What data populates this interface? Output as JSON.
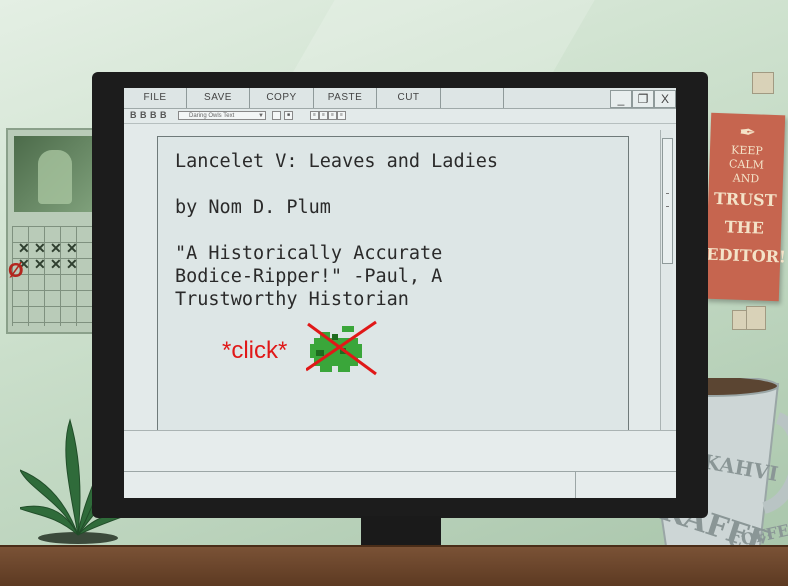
{
  "toolbar": {
    "menu": [
      "FILE",
      "SAVE",
      "COPY",
      "PASTE",
      "CUT"
    ],
    "window_buttons": [
      "_",
      "❐",
      "X"
    ]
  },
  "format_bar": {
    "style_buttons": [
      "B",
      "B",
      "B",
      "B"
    ],
    "font_name": "Daring Owls Text"
  },
  "document": {
    "lines": [
      "Lancelet V: Leaves and Ladies",
      "by Nom D. Plum",
      "\"A Historically Accurate",
      "Bodice-Ripper!\" -Paul, A",
      "Trustworthy Historian"
    ]
  },
  "annotation": {
    "click_text": "*click*",
    "icon": "crossed-out-green-apple-icon",
    "color": "#e01818"
  },
  "poster": {
    "line1": "KEEP",
    "line2": "CALM",
    "line3": "AND",
    "line4": "TRUST",
    "line5": "THE",
    "line6": "EDITOR!"
  },
  "mug": {
    "word1": "KAHVI",
    "word2": "KAFFE",
    "word3": "COFFEE"
  },
  "colors": {
    "screen_bg": "#e3eaea",
    "text": "#2a2a2a",
    "monitor": "#1c1c1c",
    "poster": "#c6654f",
    "apple": "#3aa63a"
  }
}
